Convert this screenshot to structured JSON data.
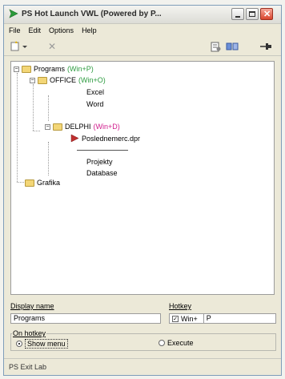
{
  "window": {
    "title": "PS Hot Launch VWL (Powered by P...",
    "status": "PS Exit Lab"
  },
  "menu": [
    "File",
    "Edit",
    "Options",
    "Help"
  ],
  "tree": {
    "root": {
      "label": "Programs",
      "hotkey": "(Win+P)"
    },
    "office": {
      "label": "OFFICE",
      "hotkey": "(Win+O)"
    },
    "excel": "Excel",
    "word": "Word",
    "delphi": {
      "label": "DELPHI",
      "hotkey": "(Win+D)"
    },
    "project_file": "Poslednemerc.dpr",
    "projekty": "Projekty",
    "database": "Database",
    "grafika": "Grafika"
  },
  "form": {
    "display_name_label": "Display name",
    "display_name_value": "Programs",
    "hotkey_label": "Hotkey",
    "win_label": "Win+",
    "hotkey_value": "P",
    "on_hotkey_label": "On hotkey",
    "show_menu_label": "Show menu",
    "execute_label": "Execute"
  },
  "colors": {
    "hotkey_green": "#2e9c40",
    "hotkey_pink": "#d01c8c",
    "title_icon_green": "#2a9a3a"
  },
  "icons": {
    "title": "green-arrow-icon",
    "new": "new-item-icon",
    "delete": "delete-x-icon",
    "properties": "properties-icon",
    "run": "run-icon",
    "pin": "pin-icon"
  }
}
